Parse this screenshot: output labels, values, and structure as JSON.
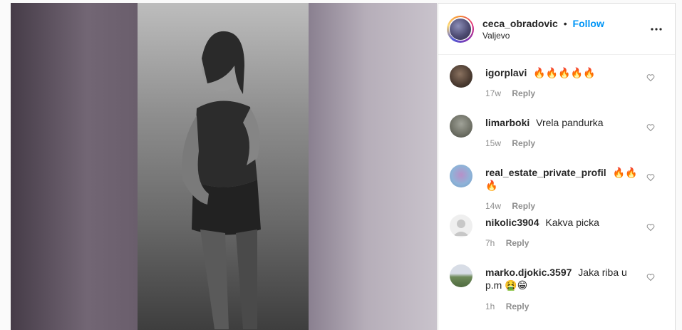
{
  "post": {
    "username": "ceca_obradovic",
    "separator": "•",
    "follow_label": "Follow",
    "location": "Valjevo",
    "more_icon": "more-horizontal-icon"
  },
  "comments": [
    {
      "username": "igorplavi",
      "text": "🔥🔥🔥🔥🔥",
      "time": "17w",
      "reply_label": "Reply",
      "avatar_color": "#5a4a40"
    },
    {
      "username": "limarboki",
      "text": "Vrela pandurka",
      "time": "15w",
      "reply_label": "Reply",
      "avatar_color": "#7a7d70"
    },
    {
      "username": "real_estate_private_profil",
      "text": "🔥🔥🔥",
      "time": "14w",
      "reply_label": "Reply",
      "avatar_color": "#8fb3d8"
    },
    {
      "username": "nikolic3904",
      "text": "Kakva picka",
      "time": "7h",
      "reply_label": "Reply",
      "avatar_color": "#e0e0e0"
    },
    {
      "username": "marko.djokic.3597",
      "text": "Jaka riba u p.m 🤮😁",
      "time": "1h",
      "reply_label": "Reply",
      "avatar_color": "#6e8a5a"
    }
  ],
  "colors": {
    "accent": "#0095f6",
    "secondary_text": "#8e8e8e",
    "border": "#dbdbdb"
  }
}
